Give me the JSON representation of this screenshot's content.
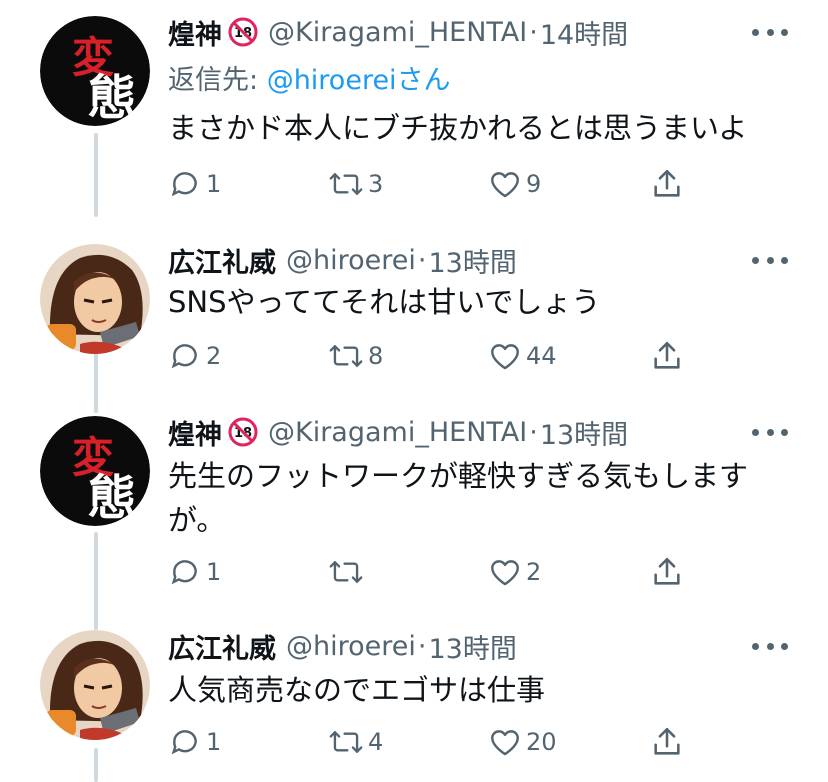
{
  "tweets": [
    {
      "name": "煌神",
      "handle": "@Kiragami_HENTAI",
      "separator": "·",
      "time": "14時間",
      "avatar_text": [
        "変",
        "態"
      ],
      "reply_label": "返信先: ",
      "reply_to": "@hiroerei",
      "reply_suffix": "さん",
      "text": "まさかド本人にブチ抜かれるとは思うまいよ",
      "replies": "1",
      "retweets": "3",
      "likes": "9"
    },
    {
      "name": "広江礼威",
      "handle": "@hiroerei",
      "separator": "·",
      "time": "13時間",
      "text": "SNSやっててそれは甘いでしょう",
      "replies": "2",
      "retweets": "8",
      "likes": "44"
    },
    {
      "name": "煌神",
      "handle": "@Kiragami_HENTAI",
      "separator": "·",
      "time": "13時間",
      "avatar_text": [
        "変",
        "態"
      ],
      "text_line1": "先生のフットワークが軽快すぎる気もします",
      "text_line2": "が。",
      "replies": "1",
      "retweets": "",
      "likes": "2"
    },
    {
      "name": "広江礼威",
      "handle": "@hiroerei",
      "separator": "·",
      "time": "13時間",
      "text": "人気商売なのでエゴサは仕事",
      "replies": "1",
      "retweets": "4",
      "likes": "20"
    }
  ],
  "colors": {
    "text": "#0f1419",
    "secondary": "#536471",
    "link": "#1d9bf0",
    "thread_line": "#cfd9de",
    "badge_red": "#e0245e"
  },
  "icons": {
    "reply": "reply-icon",
    "retweet": "retweet-icon",
    "like": "heart-icon",
    "share": "share-icon",
    "more": "more-dots-icon",
    "age_badge": "no-under-18-icon"
  }
}
